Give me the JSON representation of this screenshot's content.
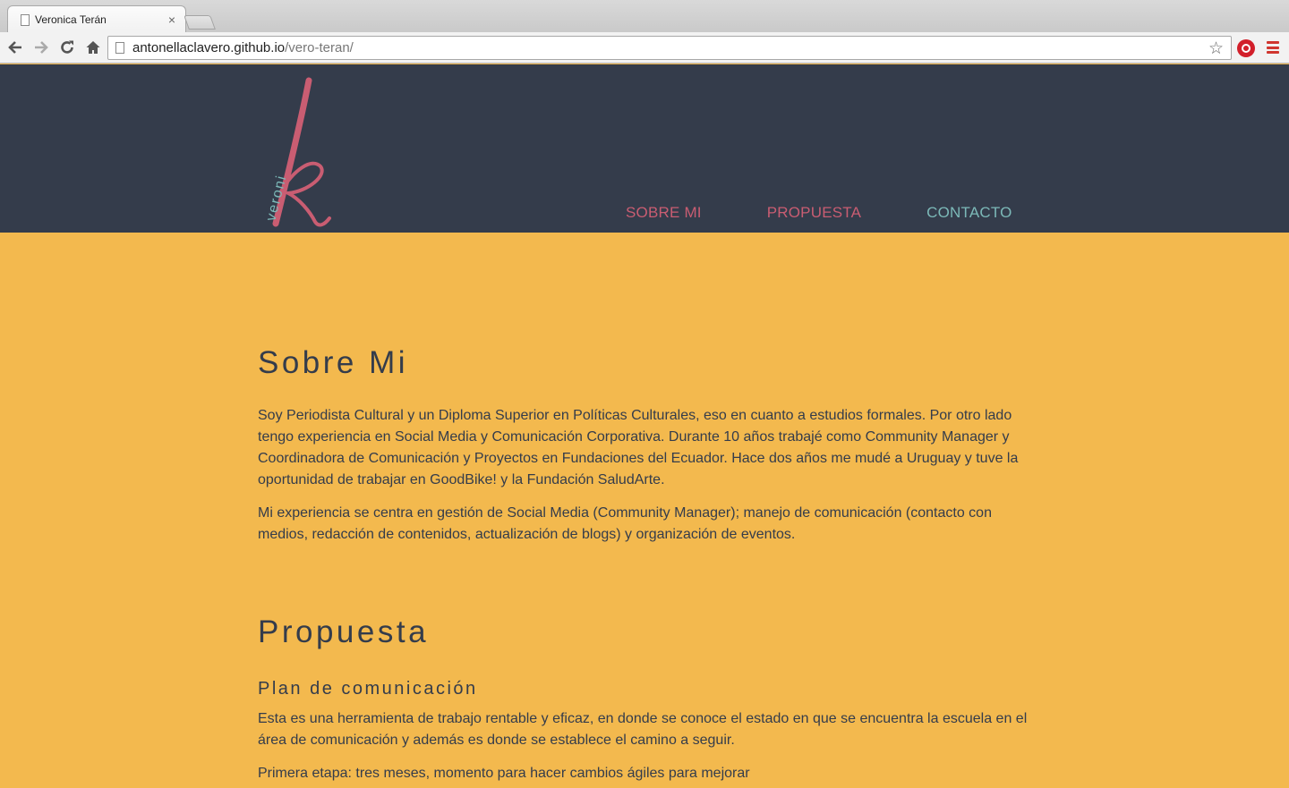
{
  "browser": {
    "tab_title": "Veronica Terán",
    "tab_close": "×",
    "url_host": "antonellaclavero.github.io",
    "url_path": "/vero-teran/"
  },
  "site": {
    "logo_text": "veroni",
    "logo_letter": "k",
    "colors": {
      "header_bg": "#343c4b",
      "page_bg": "#f3b94e",
      "accent_pink": "#c95d72",
      "accent_teal": "#7cb9b8"
    },
    "nav": [
      {
        "label": "SOBRE MI"
      },
      {
        "label": "PROPUESTA"
      },
      {
        "label": "CONTACTO"
      }
    ]
  },
  "sobre": {
    "title": "Sobre Mi",
    "p1": "Soy Periodista Cultural y un Diploma Superior en Políticas Culturales, eso en cuanto a estudios formales. Por otro lado tengo experiencia en Social Media y Comunicación Corporativa. Durante 10 años trabajé como Community Manager y Coordinadora de Comunicación y Proyectos en Fundaciones del Ecuador. Hace dos años me mudé a Uruguay y tuve la oportunidad de trabajar en GoodBike! y la Fundación SaludArte.",
    "p2": "Mi experiencia se centra en gestión de Social Media (Community Manager); manejo de comunicación (contacto con medios, redacción de contenidos, actualización de blogs) y organización de eventos."
  },
  "propuesta": {
    "title": "Propuesta",
    "subtitle": "Plan de comunicación",
    "p1": "Esta es una herramienta de trabajo rentable y eficaz, en donde se conoce el estado en que se encuentra la escuela en el área de comunicación y además es donde se establece el camino a seguir.",
    "p2": "Primera etapa: tres meses, momento para hacer cambios ágiles para mejorar"
  }
}
